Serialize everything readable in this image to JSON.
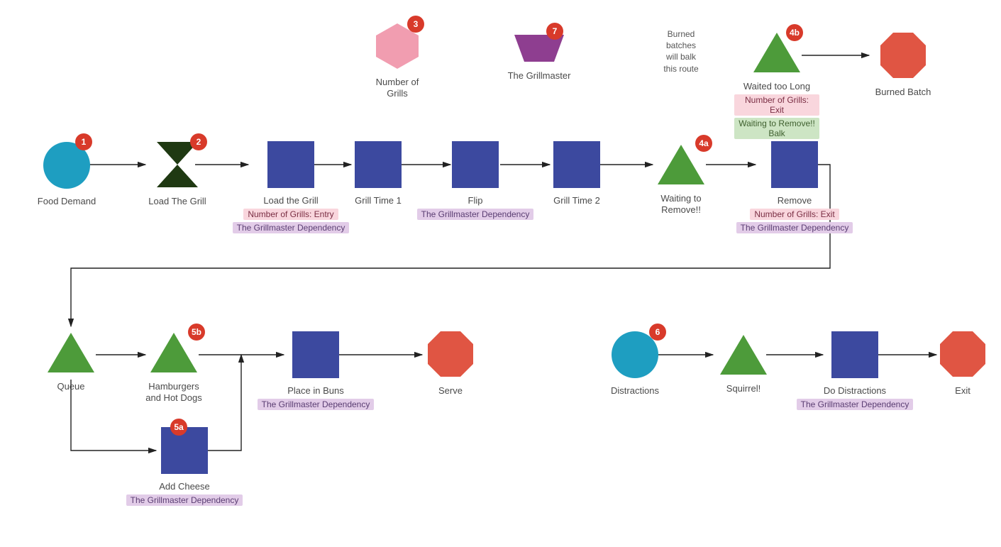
{
  "colors": {
    "source": "#1e9ec1",
    "activity": "#3c499f",
    "queue": "#4d9b3a",
    "exit": "#e05543",
    "resourceHex": "#f19db0",
    "resourceTrap": "#8e3e90",
    "hourglass": "#1f3912",
    "badge": "#d83a2a",
    "arrow": "#222"
  },
  "annotation": {
    "burned_note": "Burned\nbatches\nwill balk\nthis route"
  },
  "badges": {
    "food_demand": "1",
    "load_grill_hg": "2",
    "grills_hex": "3",
    "grillmaster": "7",
    "waiting_remove": "4a",
    "waited_long": "4b",
    "add_cheese": "5a",
    "hamburgers": "5b",
    "distractions": "6"
  },
  "nodes": {
    "food_demand": {
      "label": "Food Demand"
    },
    "load_grill_hg": {
      "label": "Load The Grill"
    },
    "load_grill_act": {
      "label": "Load the Grill",
      "tag1": "Number of Grills: Entry",
      "tag2": "The Grillmaster Dependency"
    },
    "grill_time_1": {
      "label": "Grill Time 1"
    },
    "flip": {
      "label": "Flip",
      "tag1": "The Grillmaster Dependency"
    },
    "grill_time_2": {
      "label": "Grill Time 2"
    },
    "waiting_remove": {
      "label": "Waiting to\nRemove!!"
    },
    "remove": {
      "label": "Remove",
      "tag1": "Number of Grills: Exit",
      "tag2": "The Grillmaster Dependency"
    },
    "grills_hex": {
      "label": "Number of\nGrills"
    },
    "grillmaster": {
      "label": "The Grillmaster"
    },
    "waited_long": {
      "label": "Waited too Long",
      "tag1": "Number of Grills: Exit",
      "tag2": "Waiting to Remove!! Balk"
    },
    "burned_batch": {
      "label": "Burned Batch"
    },
    "queue": {
      "label": "Queue"
    },
    "hamburgers": {
      "label": "Hamburgers\nand Hot Dogs"
    },
    "place_buns": {
      "label": "Place in Buns",
      "tag1": "The Grillmaster Dependency"
    },
    "serve": {
      "label": "Serve"
    },
    "add_cheese": {
      "label": "Add Cheese",
      "tag1": "The Grillmaster Dependency"
    },
    "distractions": {
      "label": "Distractions"
    },
    "squirrel": {
      "label": "Squirrel!"
    },
    "do_distract": {
      "label": "Do Distractions",
      "tag1": "The Grillmaster Dependency"
    },
    "exit": {
      "label": "Exit"
    }
  },
  "chart_data": {
    "type": "flowchart",
    "shapes_legend": {
      "circle": "source/generator",
      "hourglass": "combiner",
      "square": "activity",
      "triangle": "queue",
      "octagon": "sink/exit",
      "hexagon": "resource (Number of Grills)",
      "trapezoid": "resource (The Grillmaster)"
    },
    "nodes": [
      {
        "id": "food_demand",
        "shape": "circle",
        "label": "Food Demand",
        "badge": "1"
      },
      {
        "id": "load_grill_hg",
        "shape": "hourglass",
        "label": "Load The Grill",
        "badge": "2"
      },
      {
        "id": "load_grill_act",
        "shape": "square",
        "label": "Load the Grill",
        "tags": [
          "Number of Grills: Entry",
          "The Grillmaster Dependency"
        ]
      },
      {
        "id": "grill_time_1",
        "shape": "square",
        "label": "Grill Time 1"
      },
      {
        "id": "flip",
        "shape": "square",
        "label": "Flip",
        "tags": [
          "The Grillmaster Dependency"
        ]
      },
      {
        "id": "grill_time_2",
        "shape": "square",
        "label": "Grill Time 2"
      },
      {
        "id": "waiting_remove",
        "shape": "triangle",
        "label": "Waiting to Remove!!",
        "badge": "4a"
      },
      {
        "id": "remove",
        "shape": "square",
        "label": "Remove",
        "tags": [
          "Number of Grills: Exit",
          "The Grillmaster Dependency"
        ]
      },
      {
        "id": "grills_hex",
        "shape": "hexagon",
        "label": "Number of Grills",
        "badge": "3"
      },
      {
        "id": "grillmaster",
        "shape": "trapezoid",
        "label": "The Grillmaster",
        "badge": "7"
      },
      {
        "id": "waited_long",
        "shape": "triangle",
        "label": "Waited too Long",
        "badge": "4b",
        "tags": [
          "Number of Grills: Exit",
          "Waiting to Remove!! Balk"
        ]
      },
      {
        "id": "burned_batch",
        "shape": "octagon",
        "label": "Burned Batch"
      },
      {
        "id": "queue",
        "shape": "triangle",
        "label": "Queue"
      },
      {
        "id": "hamburgers",
        "shape": "triangle",
        "label": "Hamburgers and Hot Dogs",
        "badge": "5b"
      },
      {
        "id": "place_buns",
        "shape": "square",
        "label": "Place in Buns",
        "tags": [
          "The Grillmaster Dependency"
        ]
      },
      {
        "id": "serve",
        "shape": "octagon",
        "label": "Serve"
      },
      {
        "id": "add_cheese",
        "shape": "square",
        "label": "Add Cheese",
        "badge": "5a",
        "tags": [
          "The Grillmaster Dependency"
        ]
      },
      {
        "id": "distractions",
        "shape": "circle",
        "label": "Distractions",
        "badge": "6"
      },
      {
        "id": "squirrel",
        "shape": "triangle",
        "label": "Squirrel!"
      },
      {
        "id": "do_distract",
        "shape": "square",
        "label": "Do Distractions",
        "tags": [
          "The Grillmaster Dependency"
        ]
      },
      {
        "id": "exit",
        "shape": "octagon",
        "label": "Exit"
      }
    ],
    "edges": [
      [
        "food_demand",
        "load_grill_hg"
      ],
      [
        "load_grill_hg",
        "load_grill_act"
      ],
      [
        "load_grill_act",
        "grill_time_1"
      ],
      [
        "grill_time_1",
        "flip"
      ],
      [
        "flip",
        "grill_time_2"
      ],
      [
        "grill_time_2",
        "waiting_remove"
      ],
      [
        "waiting_remove",
        "remove"
      ],
      [
        "remove",
        "queue"
      ],
      [
        "queue",
        "hamburgers"
      ],
      [
        "queue",
        "add_cheese"
      ],
      [
        "hamburgers",
        "place_buns"
      ],
      [
        "add_cheese",
        "place_buns"
      ],
      [
        "place_buns",
        "serve"
      ],
      [
        "waited_long",
        "burned_batch"
      ],
      [
        "distractions",
        "squirrel"
      ],
      [
        "squirrel",
        "do_distract"
      ],
      [
        "do_distract",
        "exit"
      ]
    ],
    "annotations": [
      {
        "text": "Burned batches will balk this route",
        "near": "waited_long"
      }
    ]
  }
}
